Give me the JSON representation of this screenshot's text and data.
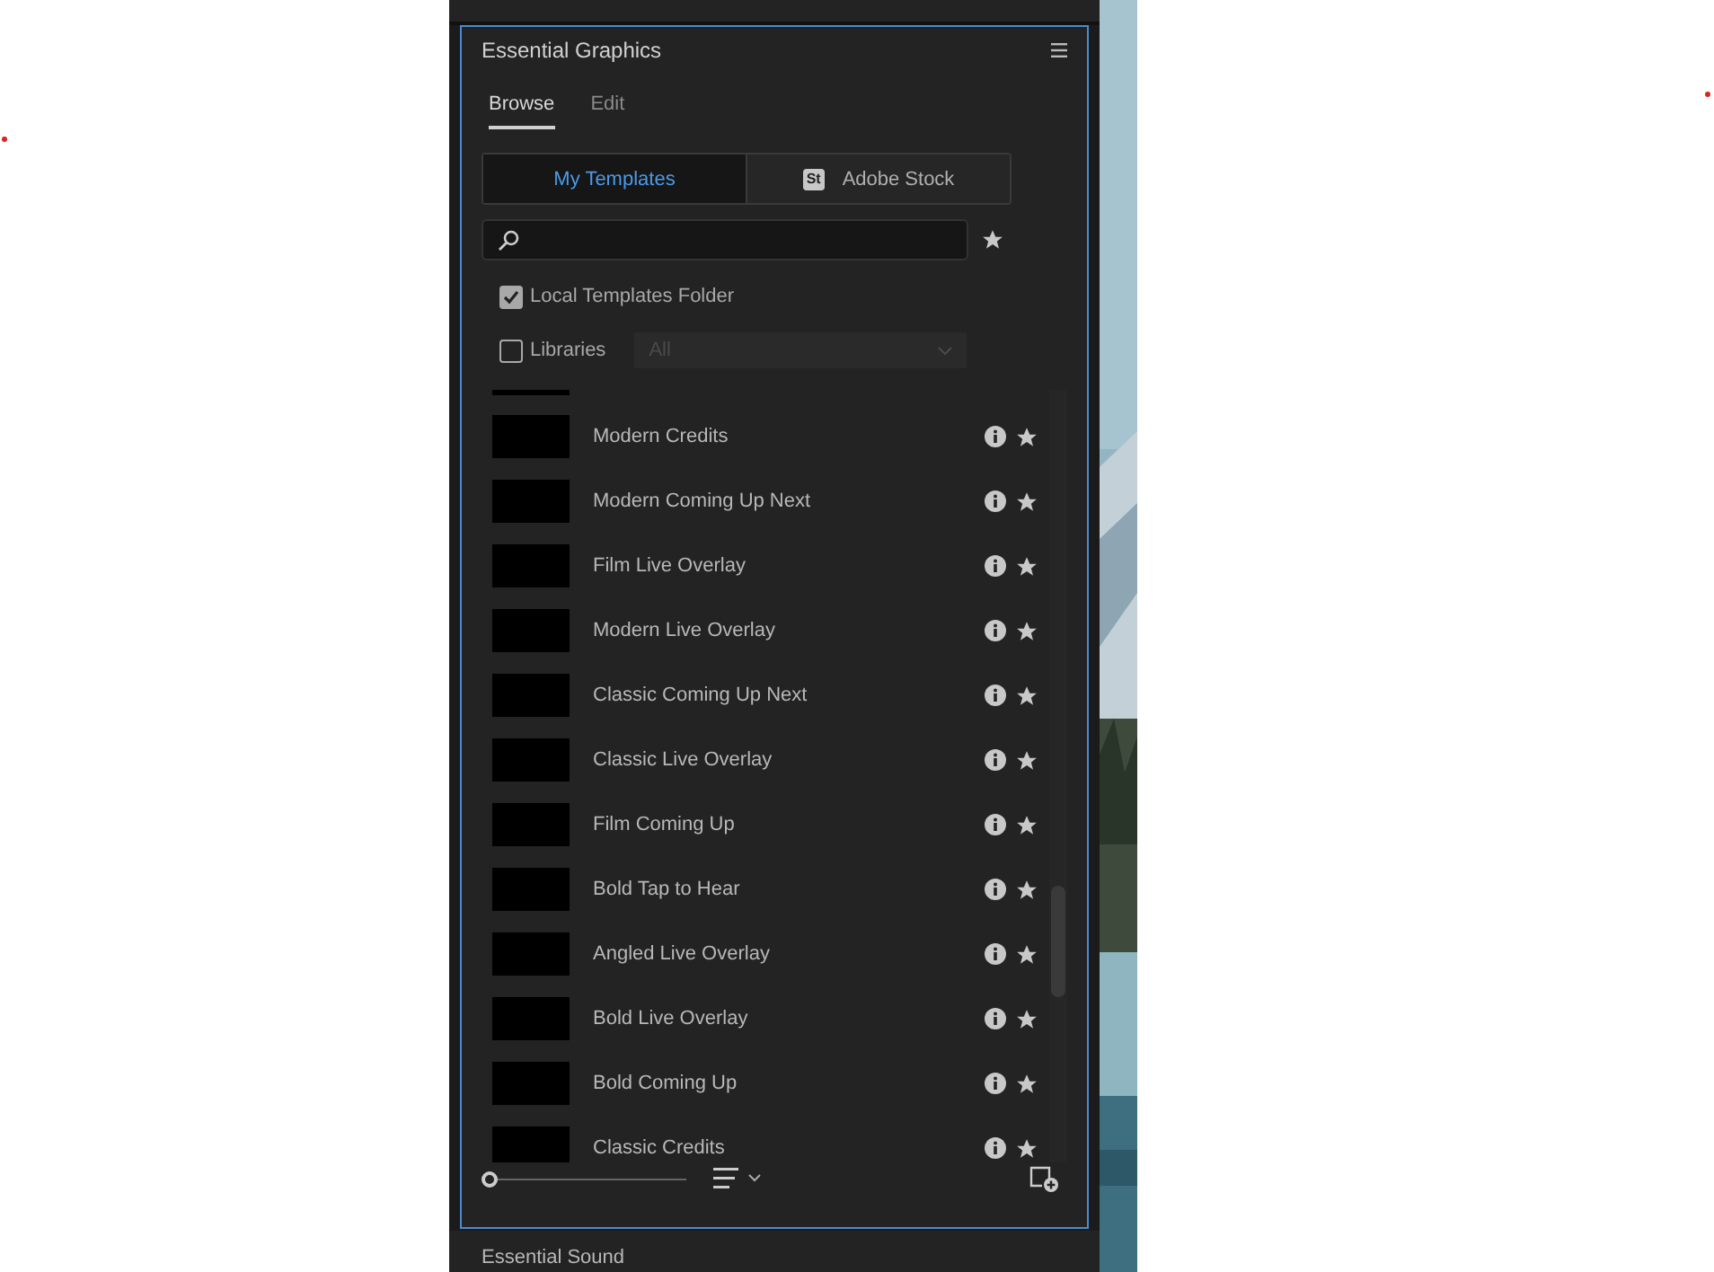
{
  "panel": {
    "title": "Essential Graphics",
    "tabs": [
      {
        "label": "Browse",
        "selected": true
      },
      {
        "label": "Edit",
        "selected": false
      }
    ],
    "sources": [
      {
        "label": "My Templates",
        "selected": true
      },
      {
        "label": "Adobe Stock",
        "badge": "St",
        "selected": false
      }
    ],
    "filters": [
      {
        "label": "Local Templates Folder",
        "checked": true
      },
      {
        "label": "Libraries",
        "checked": false,
        "dropdown": "All"
      }
    ],
    "templates": [
      {
        "name": "Modern Credits"
      },
      {
        "name": "Modern Coming Up Next"
      },
      {
        "name": "Film Live Overlay"
      },
      {
        "name": "Modern Live Overlay"
      },
      {
        "name": "Classic Coming Up Next"
      },
      {
        "name": "Classic Live Overlay"
      },
      {
        "name": "Film Coming Up"
      },
      {
        "name": "Bold Tap to Hear"
      },
      {
        "name": "Angled Live Overlay"
      },
      {
        "name": "Bold Live Overlay"
      },
      {
        "name": "Bold Coming Up"
      },
      {
        "name": "Classic Credits"
      }
    ],
    "zoom": {
      "level": 0
    }
  },
  "next_panel": {
    "title": "Essential Sound"
  }
}
